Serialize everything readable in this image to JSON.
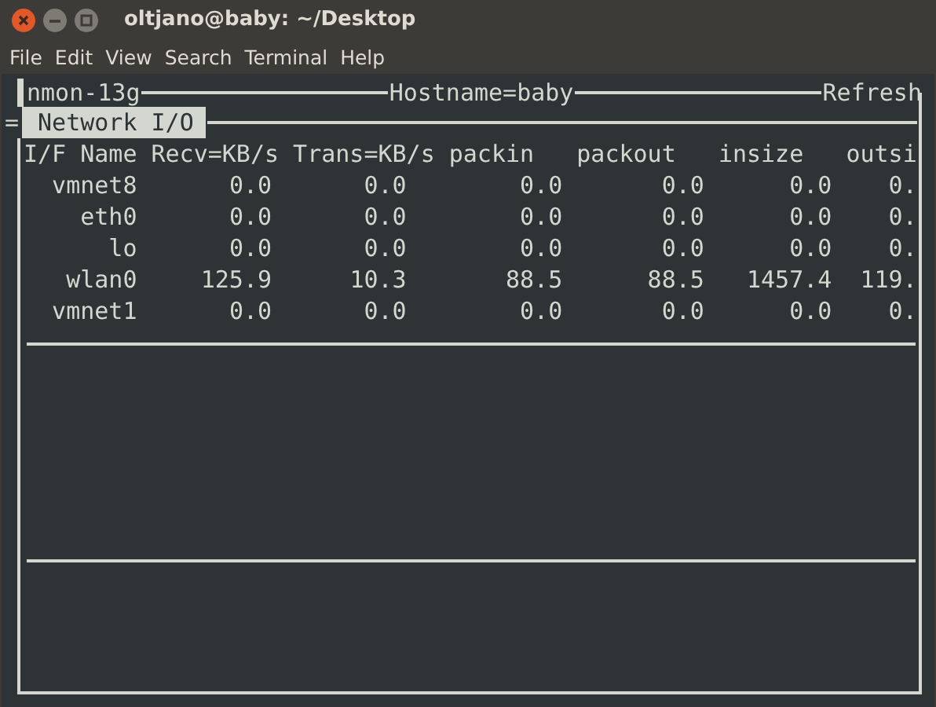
{
  "window": {
    "title": "oltjano@baby: ~/Desktop"
  },
  "menu": [
    "File",
    "Edit",
    "View",
    "Search",
    "Terminal",
    "Help"
  ],
  "nmon": {
    "program": "nmon-13g",
    "hostname": "Hostname=baby",
    "refresh": "Refresh",
    "prefix": "=",
    "section": "Network I/O"
  },
  "table": {
    "columns": [
      "I/F Name",
      "Recv=KB/s",
      "Trans=KB/s",
      "packin",
      "packout",
      "insize",
      "outsi"
    ],
    "rows": [
      [
        "vmnet8",
        "0.0",
        "0.0",
        "0.0",
        "0.0",
        "0.0",
        "0."
      ],
      [
        "eth0",
        "0.0",
        "0.0",
        "0.0",
        "0.0",
        "0.0",
        "0."
      ],
      [
        "lo",
        "0.0",
        "0.0",
        "0.0",
        "0.0",
        "0.0",
        "0."
      ],
      [
        "wlan0",
        "125.9",
        "10.3",
        "88.5",
        "88.5",
        "1457.4",
        "119."
      ],
      [
        "vmnet1",
        "0.0",
        "0.0",
        "0.0",
        "0.0",
        "0.0",
        "0."
      ]
    ]
  }
}
